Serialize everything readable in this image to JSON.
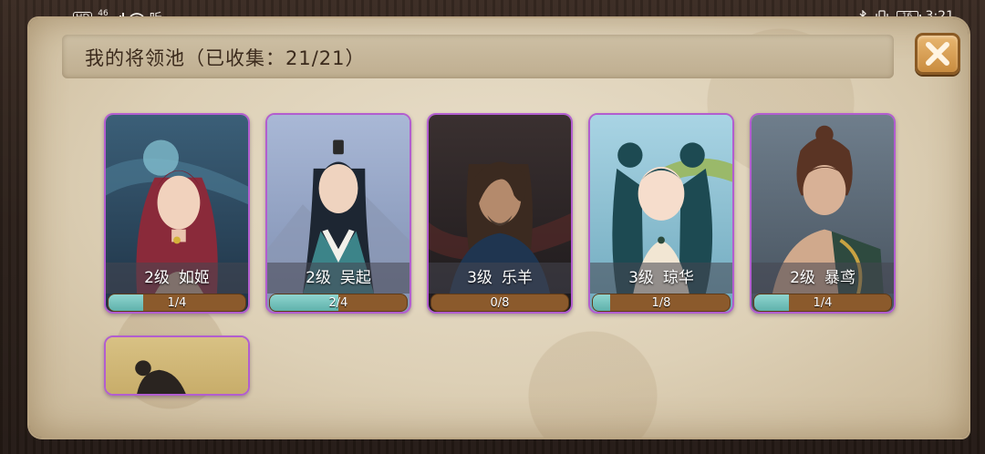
{
  "status_bar": {
    "left_chip": "HD",
    "network": "46",
    "ting": "听",
    "battery": "16",
    "time": "3:21"
  },
  "header": {
    "title": "我的将领池（已收集：21/21）",
    "close_icon": "close-icon"
  },
  "colors": {
    "card_border": "#b25ecf",
    "progress_fill": "#5fb2ab",
    "progress_track": "#8b5a2c",
    "close_button": "#d99a4c"
  },
  "cards": [
    {
      "level": "2级",
      "name": "如姬",
      "progress": "1/4",
      "fraction": 0.25
    },
    {
      "level": "2级",
      "name": "吴起",
      "progress": "2/4",
      "fraction": 0.5
    },
    {
      "level": "3级",
      "name": "乐羊",
      "progress": "0/8",
      "fraction": 0.0
    },
    {
      "level": "3级",
      "name": "琼华",
      "progress": "1/8",
      "fraction": 0.125
    },
    {
      "level": "2级",
      "name": "暴鸢",
      "progress": "1/4",
      "fraction": 0.25
    }
  ]
}
